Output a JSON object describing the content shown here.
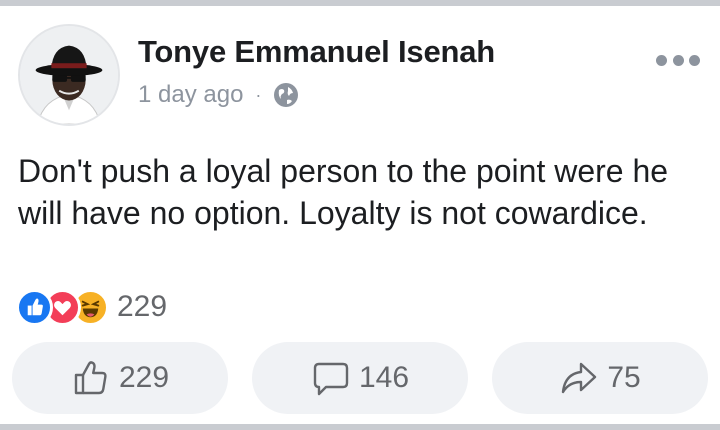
{
  "post": {
    "author": "Tonye Emmanuel Isenah",
    "time": "1 day ago",
    "separator": "·",
    "privacy_icon": "globe-icon",
    "text": "Don't push a loyal person to the point were he will have no option. Loyalty is not cowardice."
  },
  "reactions": {
    "icons": [
      "like-reaction-icon",
      "love-reaction-icon",
      "haha-reaction-icon"
    ],
    "count": "229"
  },
  "actions": {
    "like_count": "229",
    "comment_count": "146",
    "share_count": "75"
  },
  "colors": {
    "like_blue": "#1877f2",
    "love_red": "#f33e58",
    "haha_yellow": "#f7b125",
    "muted_text": "#65676b",
    "button_bg": "#f0f2f5"
  }
}
